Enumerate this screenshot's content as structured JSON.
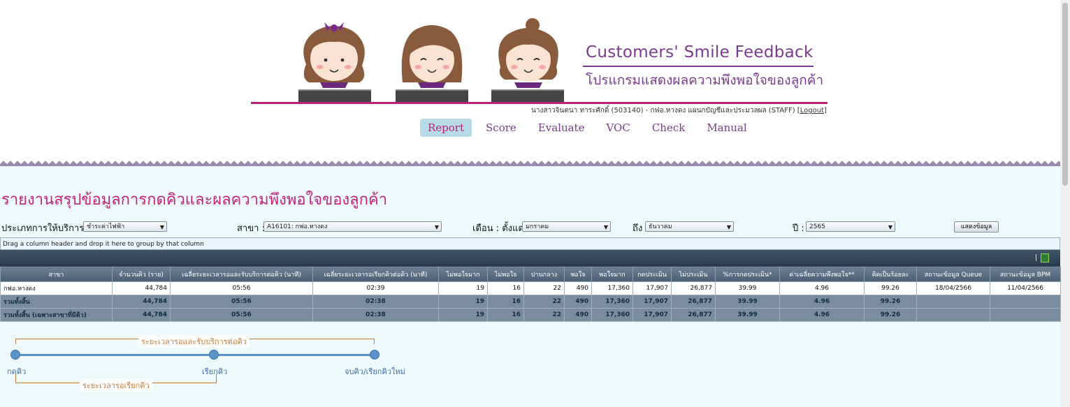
{
  "banner": {
    "title": "Customers' Smile Feedback",
    "subtitle": "โปรแกรมแสดงผลความพึงพอใจของลูกค้า"
  },
  "user": {
    "info": "นางสาวจินตนา ทาระศักดิ์ (503140) - กฟอ.หางดง แผนกบัญชีและประมวลผล (STAFF) [",
    "logout": "Logout",
    "close": "]"
  },
  "nav": {
    "items": [
      "Report",
      "Score",
      "Evaluate",
      "VOC",
      "Check",
      "Manual"
    ],
    "active": "Report"
  },
  "page": {
    "title": "รายงานสรุปข้อมูลการกดคิวและผลความพึงพอใจของลูกค้า"
  },
  "filters": {
    "service_type_label": "ประเภทการให้บริการ :",
    "service_type_value": "ชำระค่าไฟฟ้า",
    "branch_label": "สาขา :",
    "branch_value": "A16101: กฟอ.หางดง",
    "month_from_label": "เดือน : ตั้งแต่",
    "month_from_value": "มกราคม",
    "month_to_label": "ถึง",
    "month_to_value": "ธันวาคม",
    "year_label": "ปี :",
    "year_value": "2565",
    "show_button": "แสดงข้อมูล"
  },
  "grid": {
    "group_hint": "Drag a column header and drop it here to group by that column",
    "headers": [
      "สาขา",
      "จำนวนคิว (ราย)",
      "เฉลี่ยระยะเวลารอและรับบริการต่อคิว (นาที)",
      "เฉลี่ยระยะเวลารอเรียกคิวต่อคิว (นาที)",
      "ไม่พอใจมาก",
      "ไม่พอใจ",
      "ปานกลาง",
      "พอใจ",
      "พอใจมาก",
      "กดประเมิน",
      "ไม่ประเมิน",
      "%การกดประเมิน*",
      "ค่าเฉลี่ยความพึงพอใจ**",
      "คิดเป็นร้อยละ",
      "สถานะข้อมูล Queue",
      "สถานะข้อมูล BPM"
    ],
    "rows": [
      [
        "กฟอ.หางดง",
        "44,784",
        "05:56",
        "02:39",
        "19",
        "16",
        "22",
        "490",
        "17,360",
        "17,907",
        "26,877",
        "39.99",
        "4.96",
        "99.26",
        "18/04/2566",
        "11/04/2566"
      ]
    ],
    "summary_rows": [
      [
        "รวมทั้งสิ้น",
        "44,784",
        "05:56",
        "02:38",
        "19",
        "16",
        "22",
        "490",
        "17,360",
        "17,907",
        "26,877",
        "39.99",
        "4.96",
        "99.26",
        "",
        ""
      ],
      [
        "รวมทั้งสิ้น (เฉพาะสาขาที่มีคิว)",
        "44,784",
        "05:56",
        "02:38",
        "19",
        "16",
        "22",
        "490",
        "17,360",
        "17,907",
        "26,877",
        "39.99",
        "4.96",
        "99.26",
        "",
        ""
      ]
    ]
  },
  "timeline": {
    "top_bracket": "ระยะเวลารอและรับบริการต่อคิว",
    "bottom_bracket": "ระยะเวลารอเรียกคิว",
    "points": [
      "กดคิว",
      "เรียกคิว",
      "จบคิว/เรียกคิวใหม่"
    ]
  }
}
